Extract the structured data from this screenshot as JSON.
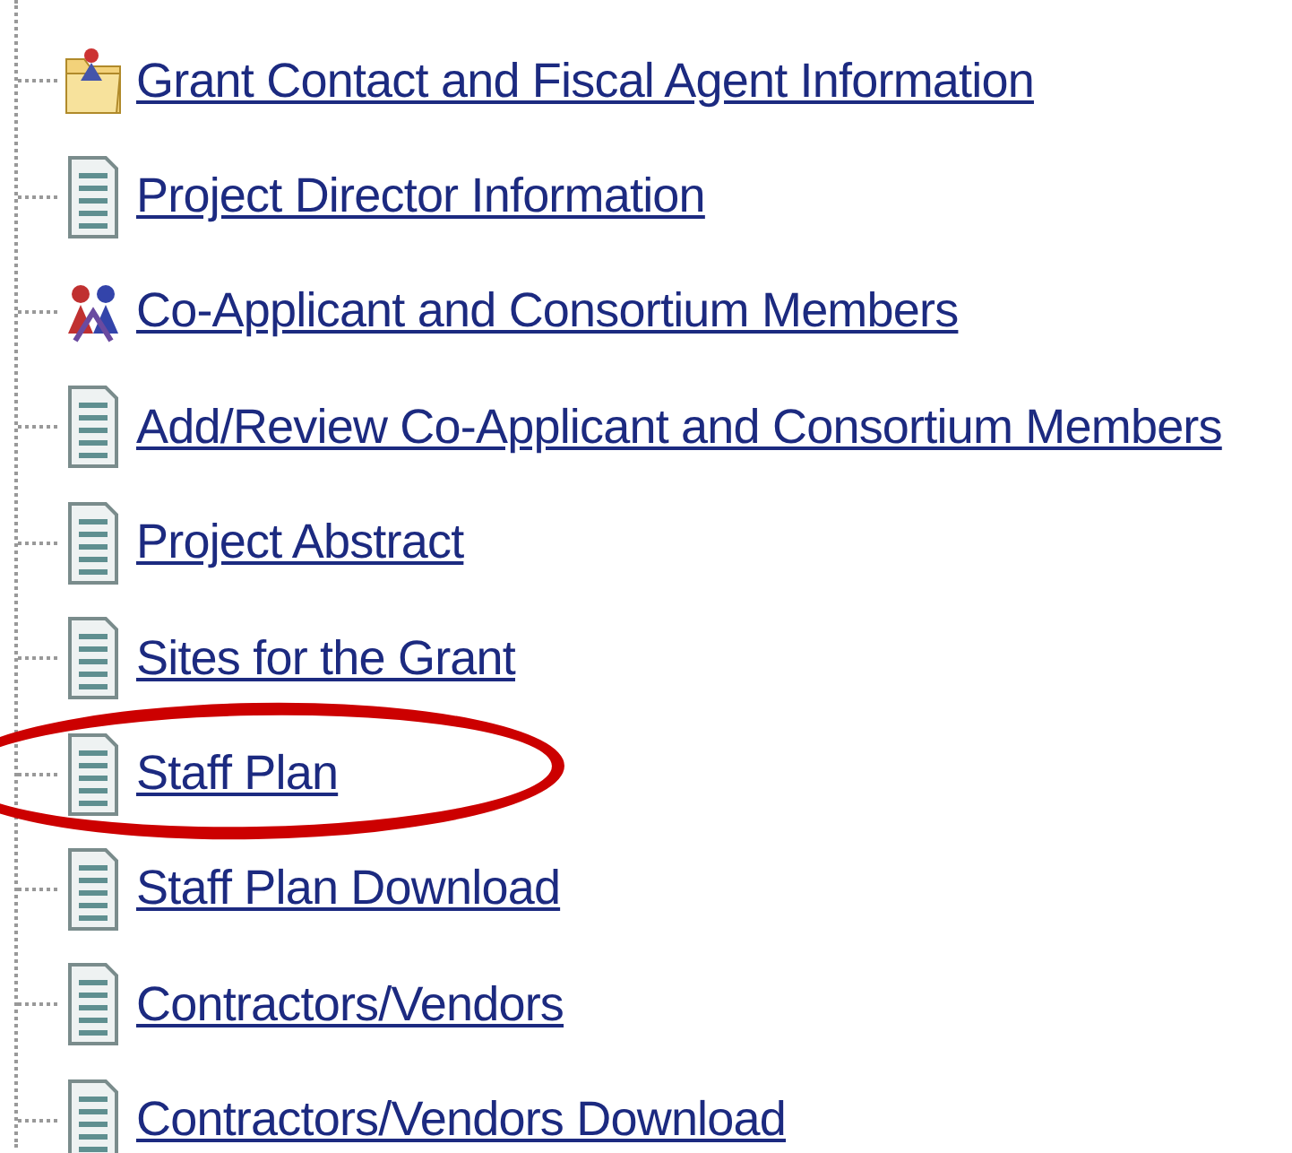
{
  "tree": {
    "items": [
      {
        "label": "Grant Contact and Fiscal Agent Information",
        "kind": "folder",
        "circled": false
      },
      {
        "label": "Project Director Information",
        "kind": "document",
        "circled": false
      },
      {
        "label": "Co-Applicant and Consortium Members",
        "kind": "people",
        "circled": false
      },
      {
        "label": "Add/Review Co-Applicant and Consortium Members",
        "kind": "document",
        "circled": false
      },
      {
        "label": "Project Abstract",
        "kind": "document",
        "circled": false
      },
      {
        "label": "Sites for the Grant",
        "kind": "document",
        "circled": false
      },
      {
        "label": "Staff Plan",
        "kind": "document",
        "circled": true
      },
      {
        "label": "Staff Plan Download",
        "kind": "document",
        "circled": false
      },
      {
        "label": "Contractors/Vendors",
        "kind": "document",
        "circled": false
      },
      {
        "label": "Contractors/Vendors Download",
        "kind": "document",
        "circled": false
      }
    ]
  }
}
